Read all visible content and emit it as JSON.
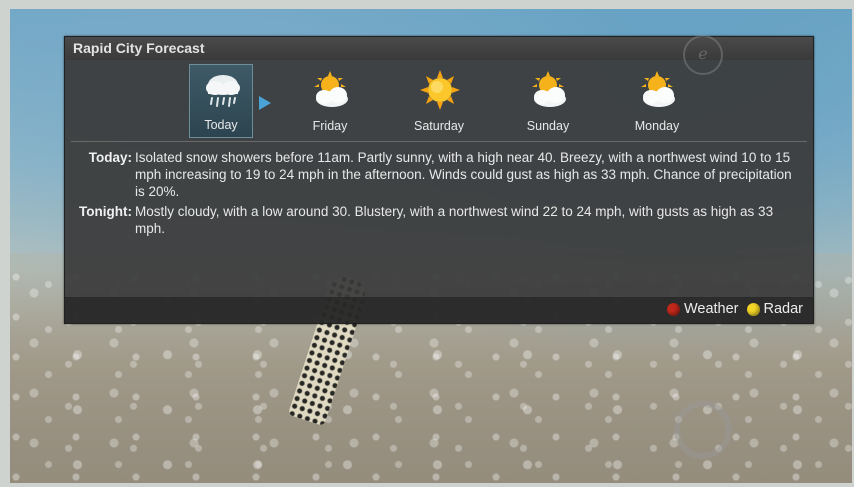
{
  "panel": {
    "title": "Rapid City Forecast"
  },
  "days": [
    {
      "label": "Today",
      "icon": "snow-shower-icon",
      "selected": true
    },
    {
      "label": "Friday",
      "icon": "partly-cloudy-icon",
      "selected": false
    },
    {
      "label": "Saturday",
      "icon": "sunny-icon",
      "selected": false
    },
    {
      "label": "Sunday",
      "icon": "partly-cloudy-icon",
      "selected": false
    },
    {
      "label": "Monday",
      "icon": "partly-cloudy-icon",
      "selected": false
    }
  ],
  "forecast": [
    {
      "label": "Today:",
      "text": "Isolated snow showers before 11am.  Partly sunny, with a high near 40. Breezy, with a northwest wind 10 to 15 mph increasing to 19 to 24 mph in the afternoon. Winds could gust as high as 33 mph. Chance of precipitation is 20%."
    },
    {
      "label": "Tonight:",
      "text": "Mostly cloudy, with a low around 30. Blustery, with a northwest wind 22 to 24 mph, with gusts as high as 33 mph."
    }
  ],
  "legend": {
    "weather_label": "Weather",
    "radar_label": "Radar",
    "weather_color": "#c0281b",
    "radar_color": "#f2d526"
  },
  "colors": {
    "selected_bg": "#2c4450",
    "arrow": "#4aa3d6"
  }
}
